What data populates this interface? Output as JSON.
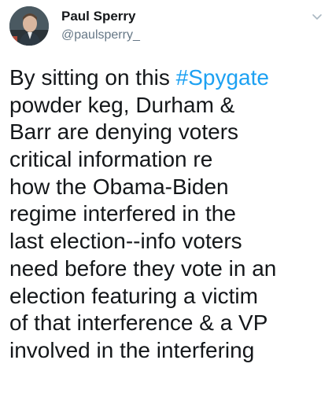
{
  "tweet": {
    "author": {
      "display_name": "Paul Sperry",
      "handle": "@paulsperry_"
    },
    "caret_icon": "chevron-down-icon",
    "text_lines": [
      {
        "before": "By sitting on this ",
        "hashtag": "#Spygate",
        "after": ""
      },
      {
        "before": "powder keg, Durham &",
        "hashtag": "",
        "after": ""
      },
      {
        "before": "Barr are denying voters",
        "hashtag": "",
        "after": ""
      },
      {
        "before": "critical information re",
        "hashtag": "",
        "after": ""
      },
      {
        "before": "how the Obama-Biden",
        "hashtag": "",
        "after": ""
      },
      {
        "before": "regime interfered in the",
        "hashtag": "",
        "after": ""
      },
      {
        "before": "last election--info voters",
        "hashtag": "",
        "after": ""
      },
      {
        "before": "need before they vote in an",
        "hashtag": "",
        "after": ""
      },
      {
        "before": "election featuring a victim",
        "hashtag": "",
        "after": ""
      },
      {
        "before": "of that interference & a VP",
        "hashtag": "",
        "after": ""
      },
      {
        "before": "involved in the interfering",
        "hashtag": "",
        "after": ""
      }
    ]
  },
  "colors": {
    "text": "#14171a",
    "secondary": "#657786",
    "hashtag": "#1da1f2"
  }
}
